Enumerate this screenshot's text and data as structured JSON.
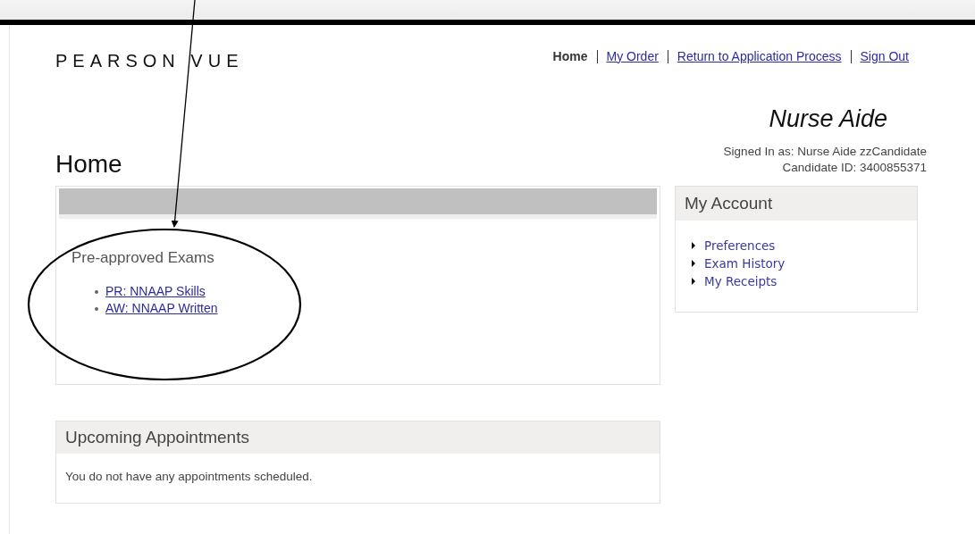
{
  "header": {
    "logo": "PEARSON VUE",
    "nav": [
      {
        "label": "Home",
        "selected": true
      },
      {
        "label": "My Order",
        "selected": false
      },
      {
        "label": "Return to Application Process",
        "selected": false
      },
      {
        "label": "Sign Out",
        "selected": false
      }
    ],
    "program": "Nurse Aide",
    "signed_in": "Signed In as: Nurse Aide zzCandidate",
    "candidate_id": "Candidate ID: 3400855371"
  },
  "page_title": "Home",
  "exams_panel": {
    "heading": "Pre-approved Exams",
    "links": [
      "PR: NNAAP Skills",
      "AW: NNAAP Written"
    ]
  },
  "appointments_panel": {
    "title": "Upcoming Appointments",
    "message": "You do not have any appointments scheduled."
  },
  "account_panel": {
    "title": "My Account",
    "links": [
      "Preferences",
      "Exam History",
      "My Receipts"
    ]
  }
}
